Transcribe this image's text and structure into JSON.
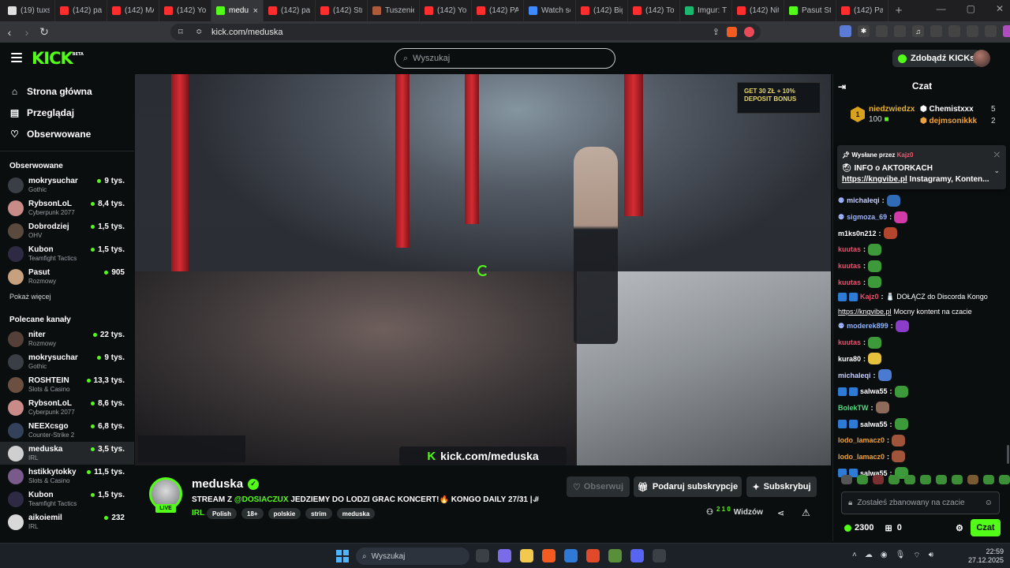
{
  "browser": {
    "tabs": [
      {
        "title": "(19) tuxs",
        "color": "#dfdfdf"
      },
      {
        "title": "(142) paj",
        "color": "#ff2d2d"
      },
      {
        "title": "(142) MA",
        "color": "#ff2d2d"
      },
      {
        "title": "(142) You",
        "color": "#ff2d2d"
      },
      {
        "title": "medu",
        "color": "#53fc18",
        "active": true
      },
      {
        "title": "(142) paj",
        "color": "#ff2d2d"
      },
      {
        "title": "(142) Stre",
        "color": "#ff2d2d"
      },
      {
        "title": "Tuszenie",
        "color": "#b05a3c"
      },
      {
        "title": "(142) You",
        "color": "#ff2d2d"
      },
      {
        "title": "(142) PAI",
        "color": "#ff2d2d"
      },
      {
        "title": "Watch se",
        "color": "#3d8bff"
      },
      {
        "title": "(142) Big",
        "color": "#ff2d2d"
      },
      {
        "title": "(142) To",
        "color": "#ff2d2d"
      },
      {
        "title": "Imgur: Th",
        "color": "#1bb76e"
      },
      {
        "title": "(142) Nit",
        "color": "#ff2d2d"
      },
      {
        "title": "Pasut Str",
        "color": "#53fc18"
      },
      {
        "title": "(142) Paj",
        "color": "#ff2d2d"
      }
    ],
    "url": "kick.com/meduska"
  },
  "header": {
    "logo": "KICK",
    "logo_beta": "BETA",
    "search_placeholder": "Wyszukaj",
    "get_kicks": "Zdobądź KICKs"
  },
  "sidebar": {
    "nav": [
      {
        "label": "Strona główna",
        "icon": "home-icon"
      },
      {
        "label": "Przeglądaj",
        "icon": "browse-icon"
      },
      {
        "label": "Obserwowane",
        "icon": "heart-icon"
      }
    ],
    "followed_title": "Obserwowane",
    "followed": [
      {
        "name": "mokrysuchar",
        "category": "Gothic",
        "viewers": "9 tys.",
        "color": "#3a3f46"
      },
      {
        "name": "RybsonLoL",
        "category": "Cyberpunk 2077",
        "viewers": "8,4 tys.",
        "color": "#c98b88"
      },
      {
        "name": "Dobrodziej",
        "category": "OHV",
        "viewers": "1,5 tys.",
        "color": "#5a4a3e"
      },
      {
        "name": "Kubon",
        "category": "Teamfight Tactics",
        "viewers": "1,5 tys.",
        "color": "#2e2a44"
      },
      {
        "name": "Pasut",
        "category": "Rozmowy",
        "viewers": "905",
        "color": "#c7a07d"
      }
    ],
    "show_more": "Pokaż więcej",
    "recommended_title": "Polecane kanały",
    "recommended": [
      {
        "name": "niter",
        "category": "Rozmowy",
        "viewers": "22 tys.",
        "color": "#544038"
      },
      {
        "name": "mokrysuchar",
        "category": "Gothic",
        "viewers": "9 tys.",
        "color": "#3a3f46"
      },
      {
        "name": "ROSHTEIN",
        "category": "Slots & Casino",
        "viewers": "13,3 tys.",
        "color": "#6b5040"
      },
      {
        "name": "RybsonLoL",
        "category": "Cyberpunk 2077",
        "viewers": "8,6 tys.",
        "color": "#c98b88"
      },
      {
        "name": "NEEXcsgo",
        "category": "Counter-Strike 2",
        "viewers": "6,8 tys.",
        "color": "#33425a"
      },
      {
        "name": "meduska",
        "category": "IRL",
        "viewers": "3,5 tys.",
        "color": "#cfcfcf",
        "selected": true
      },
      {
        "name": "hstikkytokky",
        "category": "Slots & Casino",
        "viewers": "11,5 tys.",
        "color": "#7a5a8a"
      },
      {
        "name": "Kubon",
        "category": "Teamfight Tactics",
        "viewers": "1,5 tys.",
        "color": "#2e2a44"
      },
      {
        "name": "aikoiemil",
        "category": "IRL",
        "viewers": "232",
        "color": "#d8d8d8"
      }
    ]
  },
  "video": {
    "ad_text": "GET 30 ZŁ + 10% DEPOSIT BONUS",
    "watermark_k": "K",
    "watermark_text": "kick.com/meduska"
  },
  "stream": {
    "streamer": "meduska",
    "live": "LIVE",
    "title_prefix": "STREAM Z ",
    "title_mention": "@DOSIACZUX",
    "title_rest": " JEDZIEMY DO LODZI GRAĆ KONCERT!🔥 KONGO DAILY 27/31 | #r...",
    "category": "IRL",
    "tags": [
      "Polish",
      "18+",
      "polskie",
      "strim",
      "meduska"
    ],
    "follow_label": "Obserwuj",
    "gift_label": "Podaruj subskrypcje",
    "subscribe_label": "Subskrybuj",
    "viewers_label": "Widzów"
  },
  "chat": {
    "title": "Czat",
    "leaderboard": {
      "first_rank": "1",
      "first_name": "niedzwiedzx",
      "first_value": "100",
      "second_name": "Chemistxxx",
      "second_value": "5",
      "third_name": "dejmsonikkk",
      "third_value": "2"
    },
    "pinned": {
      "sent_by": "Wysłane przez",
      "user": "Kajz0",
      "line1": "INFO o AKTORKACH",
      "link": "https://kngvibe.pl",
      "line2_rest": " Instagramy, Konten..."
    },
    "messages": [
      {
        "user": "michaleqi",
        "color": "#c8d0ff",
        "text": "",
        "emote": "#2f6cb5"
      },
      {
        "user": "sigmoza_69",
        "color": "#9db3ff",
        "text": "",
        "emote": "#d23aa8"
      },
      {
        "user": "m1ks0n212",
        "color": "#ffffff",
        "text": "",
        "emote": "#b5462e"
      },
      {
        "user": "kuutas",
        "color": "#ee4f6b",
        "text": "",
        "emote": "#3d9a3a"
      },
      {
        "user": "kuutas",
        "color": "#ee4f6b",
        "text": "",
        "emote": "#3d9a3a"
      },
      {
        "user": "kuutas",
        "color": "#ee4f6b",
        "text": "",
        "emote": "#3d9a3a"
      },
      {
        "user": "Kajz0",
        "color": "#ee4f6b",
        "text": "🧂 DOŁĄCZ do Discorda Kongo",
        "link": "https://kngvibe.pl",
        "text2": " Mocny kontent na czacie",
        "badges": true
      },
      {
        "user": "moderek899",
        "color": "#8fb4ff",
        "text": "",
        "emote": "#8b3cc9"
      },
      {
        "user": "kuutas",
        "color": "#ee4f6b",
        "text": "",
        "emote": "#3d9a3a"
      },
      {
        "user": "kura80",
        "color": "#ffffff",
        "text": "",
        "emote": "#e6c23c"
      },
      {
        "user": "michaleqi",
        "color": "#c8d0ff",
        "text": "",
        "emote": "#4a7bd0"
      },
      {
        "user": "salwa55",
        "color": "#ffffff",
        "text": "",
        "emote": "#3d9a3a",
        "badges": true
      },
      {
        "user": "BolekTW",
        "color": "#4ae07c",
        "text": "",
        "emote": "#8d6a5a"
      },
      {
        "user": "salwa55",
        "color": "#ffffff",
        "text": "",
        "emote": "#3d9a3a",
        "badges": true
      },
      {
        "user": "lodo_lamacz0",
        "color": "#f0a23c",
        "text": "",
        "emote": "#a0553a"
      },
      {
        "user": "lodo_lamacz0",
        "color": "#f0a23c",
        "text": "",
        "emote": "#a0553a"
      },
      {
        "user": "salwa55",
        "color": "#ffffff",
        "text": "",
        "emote": "#3d9a3a",
        "badges": true
      }
    ],
    "input_placeholder": "Zostałeś zbanowany na czacie",
    "points": "2300",
    "store_count": "0",
    "chat_button": "Czat"
  },
  "taskbar": {
    "search": "Wyszukaj",
    "time": "22:59",
    "date": "27.12.2025"
  }
}
